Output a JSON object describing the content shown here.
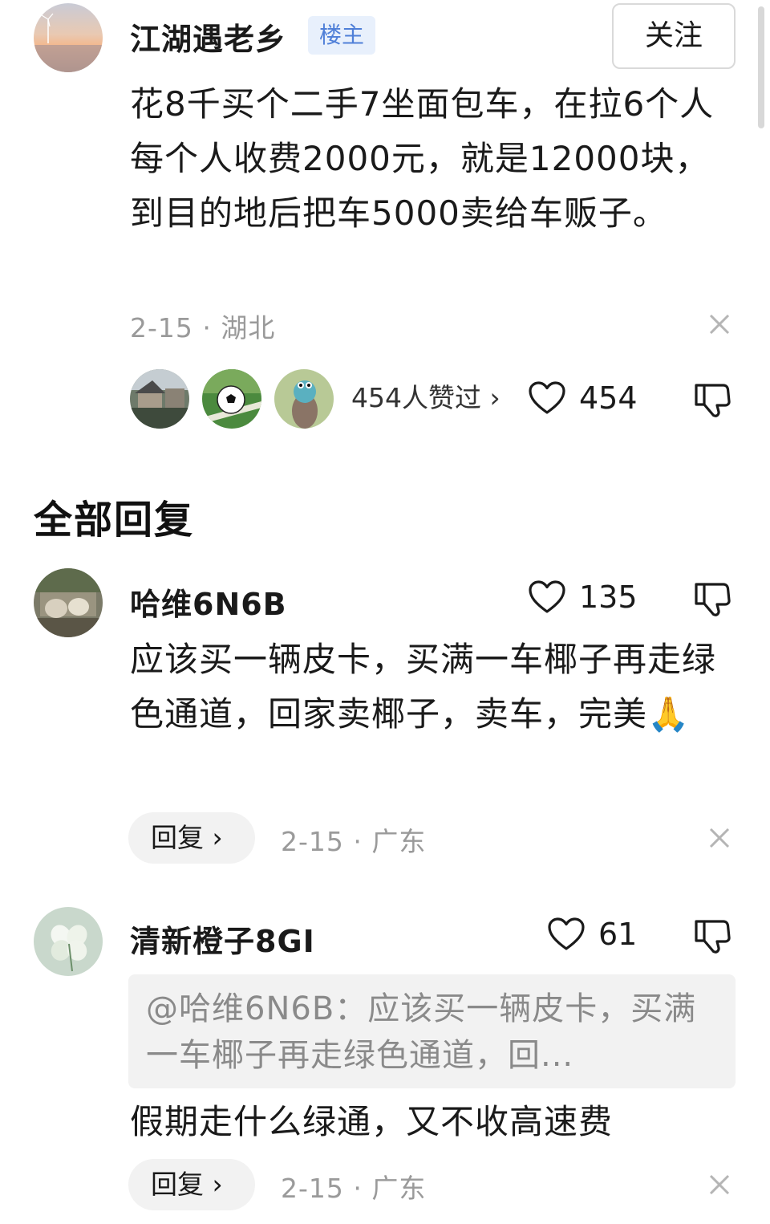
{
  "post": {
    "author": "江湖遇老乡",
    "badge": "楼主",
    "follow_label": "关注",
    "text": "花8千买个二手7坐面包车，在拉6个人每个人收费2000元，就是12000块，到目的地后把车5000卖给车贩子。",
    "date": "2-15",
    "location": "湖北",
    "likers_text": "454人赞过 ›",
    "like_count": "454"
  },
  "section_title": "全部回复",
  "replies": [
    {
      "author": "哈维6N6B",
      "like_count": "135",
      "text": "应该买一辆皮卡，买满一车椰子再走绿色通道，回家卖椰子，卖车，完美🙏",
      "reply_label": "回复 ›",
      "date": "2-15",
      "location": "广东"
    },
    {
      "author": "清新橙子8GI",
      "like_count": "61",
      "quote": "@哈维6N6B：应该买一辆皮卡，买满一车椰子再走绿色通道，回...",
      "text": "假期走什么绿通，又不收高速费",
      "reply_label": "回复 ›",
      "date": "2-15",
      "location": "广东"
    }
  ],
  "icons": {
    "like": "heart-outline-icon",
    "dislike": "thumbs-down-icon",
    "close": "close-icon"
  },
  "colors": {
    "badge_text": "#4f7fd8",
    "badge_bg": "#e8f0fc",
    "meta_text": "#9a9a9a",
    "reply_bg": "#f2f2f2"
  }
}
